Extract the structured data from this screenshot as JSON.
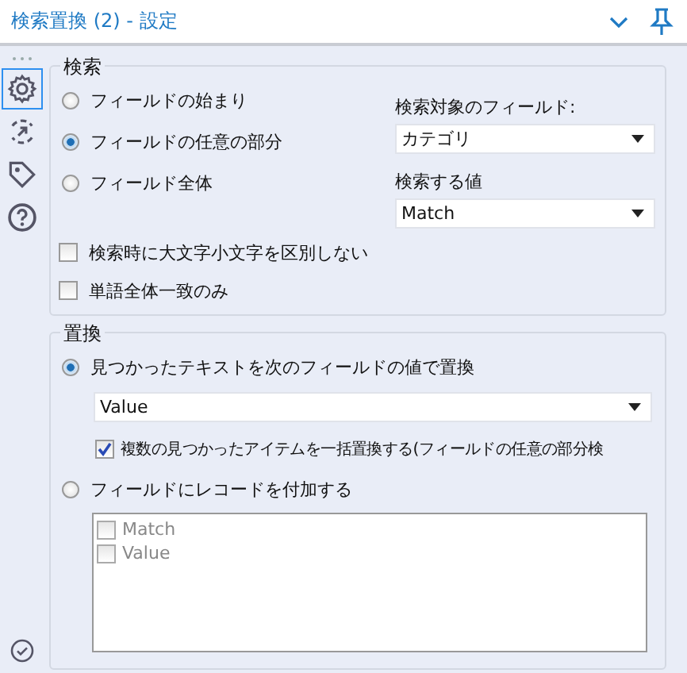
{
  "header": {
    "title": "検索置換 (2) - 設定"
  },
  "sidebar": {
    "tabs": [
      {
        "kind": "gear",
        "selected": true
      },
      {
        "kind": "arrow",
        "selected": false
      },
      {
        "kind": "tag",
        "selected": false
      },
      {
        "kind": "help",
        "selected": false
      }
    ]
  },
  "search": {
    "title": "検索",
    "options": [
      {
        "label": "フィールドの始まり",
        "selected": false
      },
      {
        "label": "フィールドの任意の部分",
        "selected": true
      },
      {
        "label": "フィールド全体",
        "selected": false
      }
    ],
    "field_label": "検索対象のフィールド:",
    "field": "カテゴリ",
    "value_label": "検索する値",
    "value": "Match",
    "checkboxes": [
      {
        "label": "検索時に大文字小文字を区別しない",
        "checked": false
      },
      {
        "label": "単語全体一致のみ",
        "checked": false
      }
    ]
  },
  "replace": {
    "title": "置換",
    "replace_option": {
      "label": "見つかったテキストを次のフィールドの値で置換",
      "selected": true
    },
    "replace_field": "Value",
    "replace_all": {
      "label": "複数の見つかったアイテムを一括置換する(フィールドの任意の部分検",
      "checked": true
    },
    "append_option": {
      "label": "フィールドにレコードを付加する",
      "selected": false
    },
    "append_fields": [
      {
        "label": "Match",
        "checked": false,
        "disabled": true
      },
      {
        "label": "Value",
        "checked": false,
        "disabled": true
      }
    ]
  }
}
